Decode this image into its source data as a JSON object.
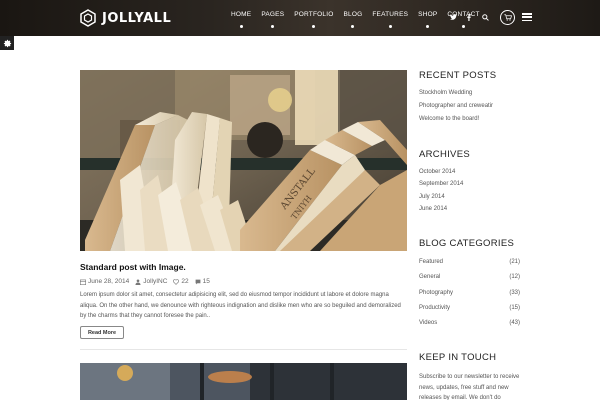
{
  "header": {
    "logo_text": "JOLLYALL",
    "nav": [
      "HOME",
      "PAGES",
      "PORTFOLIO",
      "BLOG",
      "FEATURES",
      "SHOP",
      "CONTACT"
    ],
    "icons": [
      "twitter-icon",
      "facebook-icon",
      "search-icon",
      "cart-icon",
      "menu-icon"
    ]
  },
  "post": {
    "title": "Standard post with Image.",
    "date": "June 28, 2014",
    "author": "JollyINC",
    "likes": "22",
    "comments": "15",
    "excerpt": "Lorem ipsum dolor sit amet, consectetur adipisicing elit, sed do eiusmod tempor incididunt ut labore et dolore magna aliqua. On the other hand, we denounce with righteous indignation and dislike men who are so beguiled and demoralized by the charms that they cannot foresee the pain..",
    "read_more": "Read More"
  },
  "sidebar": {
    "recent_title": "RECENT POSTS",
    "recent": [
      "Stockholm Wedding",
      "Photographer and creweatir",
      "Welcome to the board!"
    ],
    "archives_title": "ARCHIVES",
    "archives": [
      "October 2014",
      "September 2014",
      "July 2014",
      "June 2014"
    ],
    "categories_title": "BLOG CATEGORIES",
    "categories": [
      {
        "name": "Featured",
        "count": "(21)"
      },
      {
        "name": "General",
        "count": "(12)"
      },
      {
        "name": "Photography",
        "count": "(33)"
      },
      {
        "name": "Productivity",
        "count": "(15)"
      },
      {
        "name": "Videos",
        "count": "(43)"
      }
    ],
    "keep_title": "KEEP IN TOUCH",
    "newsletter": "Subscribe to our newsletter to receive news, updates, free stuff and new releases by email. We don't do"
  },
  "colors": {
    "header_bg": "#2a2520",
    "accent": "#ffffff"
  }
}
